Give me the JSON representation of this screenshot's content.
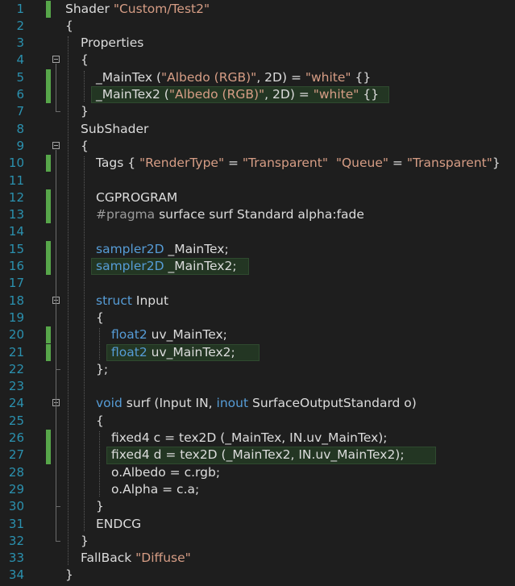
{
  "editor": {
    "lines": [
      {
        "n": "1",
        "parts": [
          [
            "",
            "Shader "
          ],
          [
            "str",
            "\"Custom/Test2\""
          ]
        ],
        "change": true
      },
      {
        "n": "2",
        "parts": [
          [
            "",
            "{"
          ]
        ]
      },
      {
        "n": "3",
        "parts": [
          [
            "",
            "Properties"
          ]
        ]
      },
      {
        "n": "4",
        "parts": [
          [
            "",
            "{"
          ]
        ]
      },
      {
        "n": "5",
        "parts": [
          [
            "",
            "_MainTex ("
          ],
          [
            "str",
            "\"Albedo (RGB)\""
          ],
          [
            "",
            ", 2D) = "
          ],
          [
            "str",
            "\"white\""
          ],
          [
            "",
            " {}"
          ]
        ],
        "change": true
      },
      {
        "n": "6",
        "parts": [
          [
            "",
            "_MainTex2 ("
          ],
          [
            "str",
            "\"Albedo (RGB)\""
          ],
          [
            "",
            ", 2D) = "
          ],
          [
            "str",
            "\"white\""
          ],
          [
            "",
            " {}"
          ]
        ],
        "change": true,
        "highlight": true
      },
      {
        "n": "7",
        "parts": [
          [
            "",
            "}"
          ]
        ]
      },
      {
        "n": "8",
        "parts": [
          [
            "",
            "SubShader"
          ]
        ]
      },
      {
        "n": "9",
        "parts": [
          [
            "",
            "{"
          ]
        ]
      },
      {
        "n": "10",
        "parts": [
          [
            "",
            "Tags { "
          ],
          [
            "str",
            "\"RenderType\""
          ],
          [
            "",
            " = "
          ],
          [
            "str",
            "\"Transparent\""
          ],
          [
            "",
            "  "
          ],
          [
            "str",
            "\"Queue\""
          ],
          [
            "",
            " = "
          ],
          [
            "str",
            "\"Transparent\""
          ],
          [
            "",
            "}"
          ]
        ],
        "change": true
      },
      {
        "n": "11",
        "parts": []
      },
      {
        "n": "12",
        "parts": [
          [
            "",
            "CGPROGRAM"
          ]
        ],
        "change": true
      },
      {
        "n": "13",
        "parts": [
          [
            "pp",
            "#pragma"
          ],
          [
            "",
            " surface surf Standard alpha:fade"
          ]
        ],
        "change": true
      },
      {
        "n": "14",
        "parts": []
      },
      {
        "n": "15",
        "parts": [
          [
            "kw",
            "sampler2D"
          ],
          [
            "",
            " _MainTex;"
          ]
        ],
        "change": true
      },
      {
        "n": "16",
        "parts": [
          [
            "kw",
            "sampler2D"
          ],
          [
            "",
            " _MainTex2;"
          ]
        ],
        "change": true,
        "highlight": true
      },
      {
        "n": "17",
        "parts": []
      },
      {
        "n": "18",
        "parts": [
          [
            "kw",
            "struct"
          ],
          [
            "",
            " Input"
          ]
        ]
      },
      {
        "n": "19",
        "parts": [
          [
            "",
            "{"
          ]
        ]
      },
      {
        "n": "20",
        "parts": [
          [
            "kw",
            "float2"
          ],
          [
            "",
            " uv_MainTex;"
          ]
        ],
        "change": true
      },
      {
        "n": "21",
        "parts": [
          [
            "kw",
            "float2"
          ],
          [
            "",
            " uv_MainTex2;"
          ]
        ],
        "change": true,
        "highlight": true
      },
      {
        "n": "22",
        "parts": [
          [
            "",
            "};"
          ]
        ]
      },
      {
        "n": "23",
        "parts": []
      },
      {
        "n": "24",
        "parts": [
          [
            "kw",
            "void"
          ],
          [
            "",
            " surf (Input IN, "
          ],
          [
            "kw",
            "inout"
          ],
          [
            "",
            " SurfaceOutputStandard o)"
          ]
        ]
      },
      {
        "n": "25",
        "parts": [
          [
            "",
            "{"
          ]
        ]
      },
      {
        "n": "26",
        "parts": [
          [
            "",
            "fixed4 c = tex2D (_MainTex, IN.uv_MainTex);"
          ]
        ],
        "change": true
      },
      {
        "n": "27",
        "parts": [
          [
            "",
            "fixed4 d = tex2D (_MainTex2, IN.uv_MainTex2);"
          ]
        ],
        "change": true,
        "highlight": true
      },
      {
        "n": "28",
        "parts": [
          [
            "",
            "o.Albedo = c.rgb;"
          ]
        ]
      },
      {
        "n": "29",
        "parts": [
          [
            "",
            "o.Alpha = c.a;"
          ]
        ]
      },
      {
        "n": "30",
        "parts": [
          [
            "",
            "}"
          ]
        ]
      },
      {
        "n": "31",
        "parts": [
          [
            "",
            "ENDCG"
          ]
        ]
      },
      {
        "n": "32",
        "parts": [
          [
            "",
            "}"
          ]
        ]
      },
      {
        "n": "33",
        "parts": [
          [
            "",
            "FallBack "
          ],
          [
            "str",
            "\"Diffuse\""
          ]
        ]
      },
      {
        "n": "34",
        "parts": [
          [
            "",
            "}"
          ]
        ]
      }
    ],
    "colors": {
      "background": "#1e1e1e",
      "line_number": "#2b91af",
      "keyword": "#569cd6",
      "string": "#d69d85",
      "change_bar": "#57a64a",
      "highlight": "#233623"
    }
  }
}
